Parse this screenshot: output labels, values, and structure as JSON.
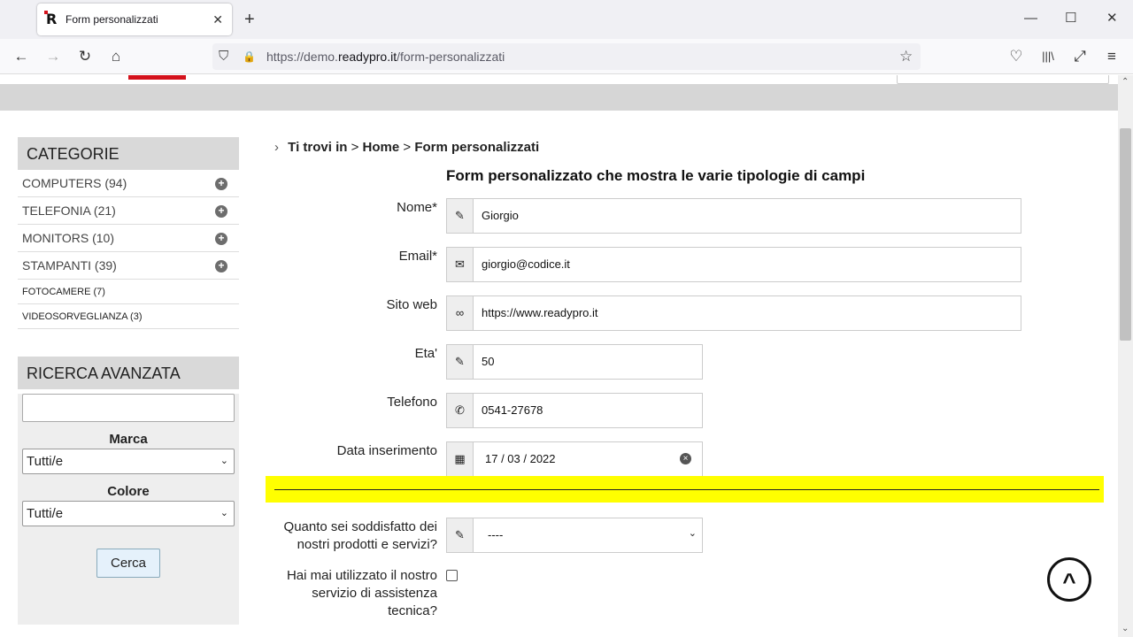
{
  "browser": {
    "tab_title": "Form personalizzati",
    "favicon_letter": "R",
    "close_glyph": "✕",
    "newtab_glyph": "+",
    "url_prefix": "https://demo.",
    "url_host": "readypro.it",
    "url_path": "/form-personalizzati",
    "icons": {
      "back": "←",
      "forward": "→",
      "reload": "↻",
      "home": "⌂",
      "shield": "⛉",
      "lock": "🔒",
      "star": "☆",
      "pocket": "♡",
      "library": "|||\\",
      "extension": "⤢",
      "menu": "≡",
      "minimize": "—",
      "maximize": "☐",
      "close": "✕"
    }
  },
  "sidebar": {
    "categories_title": "CATEGORIE",
    "categories": [
      {
        "label": "COMPUTERS (94)",
        "expandable": true
      },
      {
        "label": "TELEFONIA (21)",
        "expandable": true
      },
      {
        "label": "MONITORS (10)",
        "expandable": true
      },
      {
        "label": "STAMPANTI (39)",
        "expandable": true
      },
      {
        "label": "FOTOCAMERE (7)",
        "expandable": false
      },
      {
        "label": "VIDEOSORVEGLIANZA (3)",
        "expandable": false
      }
    ],
    "plus_glyph": "+",
    "advanced_title": "RICERCA AVANZATA",
    "search_value": "",
    "brand_label": "Marca",
    "brand_selected": "Tutti/e",
    "color_label": "Colore",
    "color_selected": "Tutti/e",
    "search_button": "Cerca"
  },
  "breadcrumb": {
    "prefix": "Ti trovi in",
    "separator": ">",
    "home": "Home",
    "current": "Form personalizzati"
  },
  "form": {
    "title": "Form personalizzato che mostra le varie tipologie di campi",
    "fields": {
      "nome": {
        "label": "Nome*",
        "value": "Giorgio",
        "icon": "pencil-icon"
      },
      "email": {
        "label": "Email*",
        "value": "giorgio@codice.it",
        "icon": "envelope-icon"
      },
      "sito": {
        "label": "Sito web",
        "value": "https://www.readypro.it",
        "icon": "link-icon"
      },
      "eta": {
        "label": "Eta'",
        "value": "50",
        "icon": "pencil-icon"
      },
      "telefono": {
        "label": "Telefono",
        "value": "0541-27678",
        "icon": "phone-icon"
      },
      "data": {
        "label": "Data inserimento",
        "value": "17 / 03 / 2022",
        "icon": "calendar-icon"
      }
    },
    "satisfaction": {
      "label_line1": "Quanto sei soddisfatto dei",
      "label_line2": "nostri prodotti e servizi?",
      "selected": "----"
    },
    "assistance": {
      "label_line1": "Hai mai utilizzato il nostro",
      "label_line2": "servizio di assistenza",
      "label_line3": "tecnica?",
      "checked": false
    }
  },
  "colors": {
    "brand_red": "#d4111b",
    "separator_band": "#ffff00",
    "sidebar_header": "#d9d9d9"
  }
}
